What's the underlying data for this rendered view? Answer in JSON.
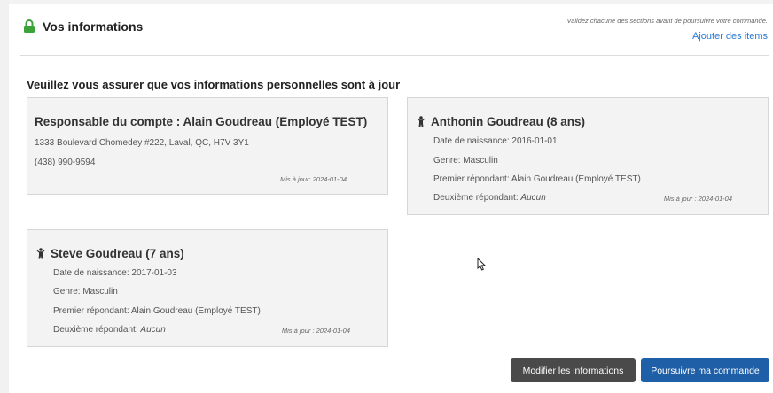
{
  "header": {
    "title": "Vos informations",
    "validate_note": "Validez chacune des sections avant de poursuivre votre commande.",
    "add_items": "Ajouter des items"
  },
  "subtitle": "Veuillez vous assurer que vos informations personnelles sont à jour",
  "account_card": {
    "name": "Responsable du compte : Alain Goudreau (Employé TEST)",
    "address": "1333 Boulevard Chomedey #222, Laval, QC, H7V 3Y1",
    "phone": "(438) 990-9594",
    "updated": "Mis à jour: 2024-01-04"
  },
  "children": [
    {
      "name": "Anthonin Goudreau (8 ans)",
      "birth_label": "Date de naissance: 2016-01-01",
      "gender_label": "Genre: Masculin",
      "first_responder": "Premier répondant: Alain Goudreau (Employé TEST)",
      "second_responder_label": "Deuxième répondant: ",
      "second_responder_value": "Aucun",
      "updated": "Mis à jour : 2024-01-04"
    },
    {
      "name": "Steve Goudreau (7 ans)",
      "birth_label": "Date de naissance: 2017-01-03",
      "gender_label": "Genre: Masculin",
      "first_responder": "Premier répondant: Alain Goudreau (Employé TEST)",
      "second_responder_label": "Deuxième répondant: ",
      "second_responder_value": "Aucun",
      "updated": "Mis à jour : 2024-01-04"
    }
  ],
  "buttons": {
    "modify": "Modifier les informations",
    "continue": "Poursuivre ma commande"
  },
  "icons": {
    "lock": "lock-icon",
    "person": "person-icon",
    "cursor": "mouse-cursor-icon"
  },
  "colors": {
    "lock_green": "#3aa33a",
    "link_blue": "#2a7bd4",
    "primary_button": "#1f5fa8",
    "secondary_button": "#4a4a4a",
    "card_background": "#f3f3f3"
  }
}
